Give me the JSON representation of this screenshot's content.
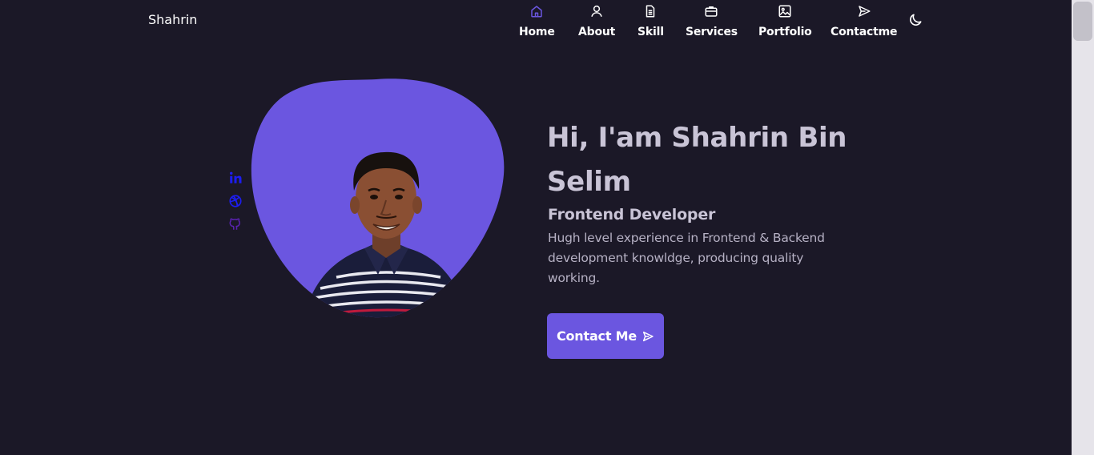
{
  "header": {
    "brand": "Shahrin",
    "nav": [
      {
        "label": "Home",
        "icon": "home-icon"
      },
      {
        "label": "About",
        "icon": "user-icon"
      },
      {
        "label": "Skill",
        "icon": "document-icon"
      },
      {
        "label": "Services",
        "icon": "briefcase-icon"
      },
      {
        "label": "Portfolio",
        "icon": "image-icon"
      },
      {
        "label": "Contactme",
        "icon": "send-icon"
      }
    ],
    "active_nav": "Home",
    "theme_icon": "moon-icon"
  },
  "social": [
    "linkedin-icon",
    "dribbble-icon",
    "github-icon"
  ],
  "hero": {
    "title": "Hi, I'am Shahrin Bin Selim",
    "subtitle": "Frontend Developer",
    "description": "Hugh level experience in Frontend & Backend development knowldge, producing quality working.",
    "cta_label": "Contact Me"
  },
  "colors": {
    "background": "#1b1827",
    "accent": "#6b56e0",
    "text_muted": "#c9c4d6",
    "social_blue": "#1d1df0",
    "social_purple": "#5a22b0"
  }
}
